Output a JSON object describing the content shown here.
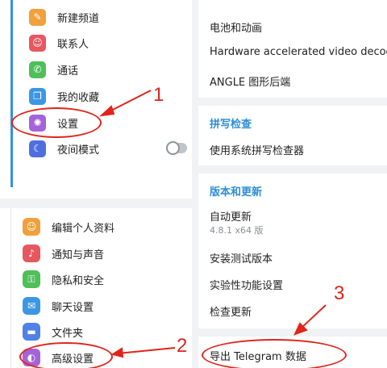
{
  "sidebar": {
    "items": [
      {
        "label": "新建频道",
        "icon": "megaphone-icon",
        "color": "#f2a03c",
        "glyph": "✎"
      },
      {
        "label": "联系人",
        "icon": "person-icon",
        "color": "#e8575f",
        "glyph": "☺"
      },
      {
        "label": "通话",
        "icon": "phone-icon",
        "color": "#4fbf5a",
        "glyph": "✆"
      },
      {
        "label": "我的收藏",
        "icon": "bookmark-icon",
        "color": "#3b97e4",
        "glyph": "❒"
      },
      {
        "label": "设置",
        "icon": "gear-icon",
        "color": "#a463d8",
        "glyph": "✺"
      },
      {
        "label": "夜间模式",
        "icon": "moon-icon",
        "color": "#4f6fe0",
        "glyph": "☾"
      }
    ]
  },
  "settings_list": {
    "items": [
      {
        "label": "编辑个人资料",
        "icon": "profile-icon",
        "color": "#f2a03c",
        "glyph": "☺"
      },
      {
        "label": "通知与声音",
        "icon": "bell-icon",
        "color": "#e8575f",
        "glyph": "♪"
      },
      {
        "label": "隐私和安全",
        "icon": "lock-icon",
        "color": "#4fbf5a",
        "glyph": "⚿"
      },
      {
        "label": "聊天设置",
        "icon": "chat-icon",
        "color": "#3b97e4",
        "glyph": "✉"
      },
      {
        "label": "文件夹",
        "icon": "folder-icon",
        "color": "#4f82e8",
        "glyph": "▬"
      },
      {
        "label": "高级设置",
        "icon": "advanced-icon",
        "color": "#a463d8",
        "glyph": "◐"
      }
    ]
  },
  "right_panel": {
    "battery": "电池和动画",
    "hw_accel": "Hardware accelerated video decod",
    "angle": "ANGLE 图形后端",
    "spell_header": "拼写检查",
    "spell_system": "使用系统拼写检查器",
    "update_header": "版本和更新",
    "auto_update": "自动更新",
    "version": "4.8.1 x64 版",
    "install_beta": "安装测试版本",
    "experimental": "实验性功能设置",
    "check_update": "检查更新",
    "export_data": "导出 Telegram 数据"
  },
  "annotations": {
    "n1": "1",
    "n2": "2",
    "n3": "3",
    "color": "#e0241b"
  }
}
